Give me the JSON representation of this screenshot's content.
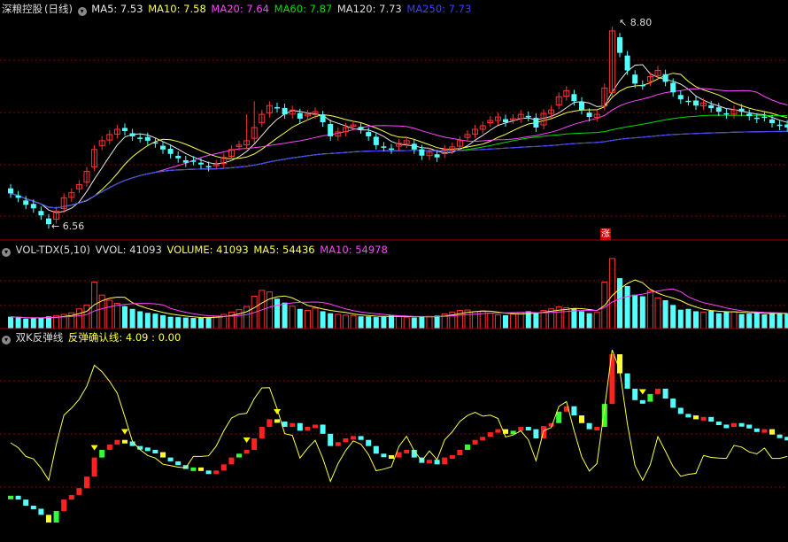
{
  "stock": {
    "name": "深粮控股",
    "period": "(日线)"
  },
  "colors": {
    "up": "#ff3232",
    "down": "#54ffff",
    "ma5": "#e8e8e8",
    "ma10": "#ffff4a",
    "ma20": "#ff44ff",
    "ma60": "#00dd00",
    "ma120": "#dddddd",
    "ma250": "#3d3dff",
    "bg": "#000000",
    "grid": "#8b0000"
  },
  "main_legend": {
    "ma5": "MA5: 7.53",
    "ma10": "MA10: 7.58",
    "ma20": "MA20: 7.64",
    "ma60": "MA60: 7.87",
    "ma120": "MA120: 7.73",
    "ma250": "MA250: 7.73"
  },
  "annotations": {
    "high": "8.80",
    "low": "6.56",
    "zhang": "涨"
  },
  "vol_legend": {
    "name": "VOL-TDX(5,10)",
    "vvol": "VVOL: 41093",
    "volume": "VOLUME: 41093",
    "ma5": "MA5: 54436",
    "ma10": "MA10: 54978"
  },
  "ind_legend": {
    "name": "双K反弹线",
    "line": "反弹确认线: 4.09 : 0.00"
  },
  "chart_data": [
    {
      "type": "candlestick",
      "title": "深粮控股(日线)",
      "y_range": [
        6.45,
        8.95
      ],
      "close": [
        6.95,
        6.9,
        6.82,
        6.78,
        6.7,
        6.6,
        6.75,
        6.9,
        6.96,
        7.05,
        7.2,
        7.45,
        7.55,
        7.62,
        7.68,
        7.66,
        7.6,
        7.58,
        7.55,
        7.52,
        7.45,
        7.4,
        7.35,
        7.3,
        7.32,
        7.28,
        7.25,
        7.28,
        7.36,
        7.45,
        7.5,
        7.55,
        7.7,
        7.85,
        7.95,
        7.92,
        7.85,
        7.9,
        7.8,
        7.85,
        7.88,
        7.76,
        7.6,
        7.65,
        7.7,
        7.73,
        7.68,
        7.6,
        7.5,
        7.48,
        7.45,
        7.52,
        7.55,
        7.45,
        7.38,
        7.42,
        7.36,
        7.45,
        7.48,
        7.55,
        7.62,
        7.68,
        7.72,
        7.78,
        7.82,
        7.76,
        7.8,
        7.85,
        7.82,
        7.7,
        7.86,
        7.9,
        8.05,
        8.12,
        8.0,
        7.9,
        7.82,
        7.85,
        8.15,
        8.8,
        8.55,
        8.35,
        8.2,
        8.18,
        8.28,
        8.35,
        8.22,
        8.1,
        8.02,
        8.0,
        7.95,
        7.98,
        7.92,
        7.88,
        7.85,
        7.9,
        7.88,
        7.83,
        7.8,
        7.82,
        7.75,
        7.72,
        7.7
      ],
      "volume": [
        30000,
        28000,
        25000,
        26000,
        27000,
        31000,
        33000,
        36000,
        40000,
        50000,
        60000,
        118000,
        85000,
        72000,
        64000,
        57000,
        50000,
        44000,
        40000,
        38000,
        34000,
        30000,
        29000,
        28000,
        27000,
        27000,
        29000,
        32000,
        36000,
        42000,
        48000,
        56000,
        82000,
        97000,
        93000,
        76000,
        66000,
        57000,
        50000,
        46000,
        52000,
        44000,
        39000,
        36000,
        34000,
        33000,
        31000,
        31000,
        29000,
        30000,
        33000,
        31000,
        29000,
        28000,
        30000,
        31000,
        33000,
        37000,
        42000,
        46000,
        47000,
        43000,
        45000,
        39000,
        35000,
        34000,
        37000,
        41000,
        44000,
        39000,
        46000,
        50000,
        55000,
        53000,
        51000,
        44000,
        39000,
        41000,
        118000,
        178000,
        128000,
        108000,
        86000,
        82000,
        96000,
        78000,
        72000,
        60000,
        48000,
        50000,
        44000,
        42000,
        45000,
        39000,
        44000,
        43000,
        37000,
        38000,
        41000,
        36000,
        39000,
        38000,
        38000
      ]
    },
    {
      "type": "bar",
      "title": "VOL-TDX(5,10)",
      "y_range": [
        0,
        180000
      ],
      "series": [
        {
          "name": "VOLUME"
        },
        {
          "name": "MA5"
        },
        {
          "name": "MA10"
        }
      ]
    },
    {
      "type": "bar",
      "title": "双K反弹线",
      "series": [
        {
          "name": "反弹确认线"
        }
      ],
      "signals_down_triangle": [
        11,
        15,
        31,
        35,
        83
      ]
    }
  ]
}
